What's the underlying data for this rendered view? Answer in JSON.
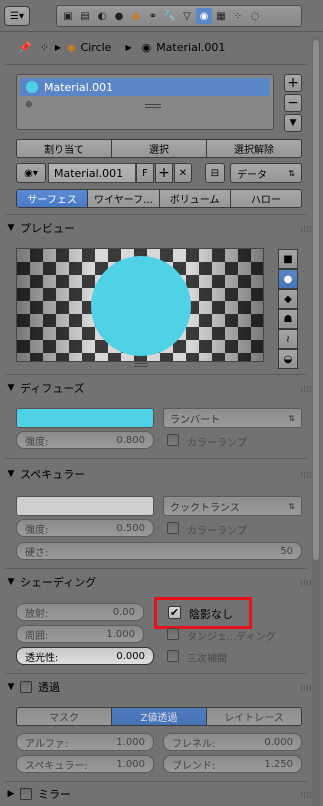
{
  "breadcrumb": {
    "object": "Circle",
    "material": "Material.001"
  },
  "slots": {
    "items": [
      "Material.001"
    ]
  },
  "assign": {
    "assign": "割り当て",
    "select": "選択",
    "deselect": "選択解除"
  },
  "datablock": {
    "name": "Material.001",
    "fake": "F",
    "link": "データ"
  },
  "type_tabs": [
    "サーフェス",
    "ワイヤーフ...",
    "ボリューム",
    "ハロー"
  ],
  "preview": {
    "title": "プレビュー",
    "sphere_color": "#4fd2e6"
  },
  "diffuse": {
    "title": "ディフューズ",
    "color": "#4fd2e6",
    "shader": "ランバート",
    "intensity_label": "強度:",
    "intensity": "0.800",
    "ramp": "カラーランプ"
  },
  "specular": {
    "title": "スペキュラー",
    "color": "#cfcfcf",
    "shader": "クックトランス",
    "intensity_label": "強度:",
    "intensity": "0.500",
    "ramp": "カラーランプ",
    "hardness_label": "硬さ:",
    "hardness": "50"
  },
  "shading": {
    "title": "シェーディング",
    "emit_label": "放射:",
    "emit": "0.00",
    "ambient_label": "周囲:",
    "ambient": "1.000",
    "translucency_label": "透光性:",
    "translucency": "0.000",
    "shadeless": "陰影なし",
    "tangent": "タンジェ...ディング",
    "cubic": "三次補間"
  },
  "transparency": {
    "title": "透過",
    "modes": [
      "マスク",
      "Z値透過",
      "レイトレース"
    ],
    "alpha_label": "アルファ:",
    "alpha": "1.000",
    "fresnel_label": "フレネル:",
    "fresnel": "0.000",
    "spec_label": "スペキュラー:",
    "spec": "1.000",
    "blend_label": "ブレンド:",
    "blend": "1.250"
  },
  "mirror": {
    "title": "ミラー"
  }
}
